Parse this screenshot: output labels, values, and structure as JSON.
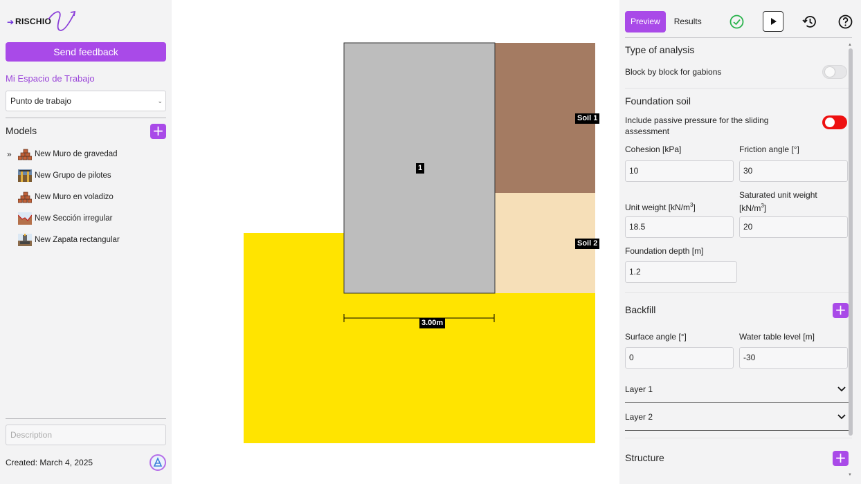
{
  "brand": {
    "name": "RISCHIO"
  },
  "sidebar": {
    "feedback_label": "Send feedback",
    "workspace_link": "Mi Espacio de Trabajo",
    "workspace_select": "Punto de trabajo",
    "models_title": "Models",
    "models": [
      {
        "label": "New Muro de gravedad",
        "icon": "gravity-wall-icon"
      },
      {
        "label": "New Grupo de pilotes",
        "icon": "pile-group-icon"
      },
      {
        "label": "New Muro en voladizo",
        "icon": "cantilever-wall-icon"
      },
      {
        "label": "New Sección irregular",
        "icon": "irregular-section-icon"
      },
      {
        "label": "New Zapata rectangular",
        "icon": "rectangular-footing-icon"
      }
    ],
    "description_placeholder": "Description",
    "created": "Created: March 4, 2025"
  },
  "canvas": {
    "block_label": "1",
    "soil1_label": "Soil 1",
    "soil2_label": "Soil 2",
    "dimension_label": "3.00m",
    "colors": {
      "block": "#bdbdbd",
      "soil1": "#a47b62",
      "soil2": "#f6dfb8",
      "foundation": "#ffe400"
    }
  },
  "panel": {
    "tabs": {
      "preview": "Preview",
      "results": "Results"
    },
    "type_of_analysis": {
      "title": "Type of analysis",
      "block_label": "Block by block for gabions",
      "block_enabled": false
    },
    "foundation_soil": {
      "title": "Foundation soil",
      "passive_label": "Include passive pressure for the sliding assessment",
      "passive_enabled": true,
      "cohesion_label": "Cohesion [kPa]",
      "cohesion_value": "10",
      "friction_label": "Friction angle [°]",
      "friction_value": "30",
      "unit_weight_label": "Unit weight [kN/m",
      "unit_weight_sup": "3",
      "unit_weight_close": "]",
      "unit_weight_value": "18.5",
      "sat_weight_label_1": "Saturated unit weight",
      "sat_weight_label_2": "[kN/m",
      "sat_weight_sup": "3",
      "sat_weight_close": "]",
      "sat_weight_value": "20",
      "depth_label": "Foundation depth [m]",
      "depth_value": "1.2"
    },
    "backfill": {
      "title": "Backfill",
      "surface_label": "Surface angle [°]",
      "surface_value": "0",
      "water_label": "Water table level [m]",
      "water_value": "-30",
      "layers": [
        "Layer 1",
        "Layer 2"
      ]
    },
    "structure": {
      "title": "Structure"
    }
  }
}
